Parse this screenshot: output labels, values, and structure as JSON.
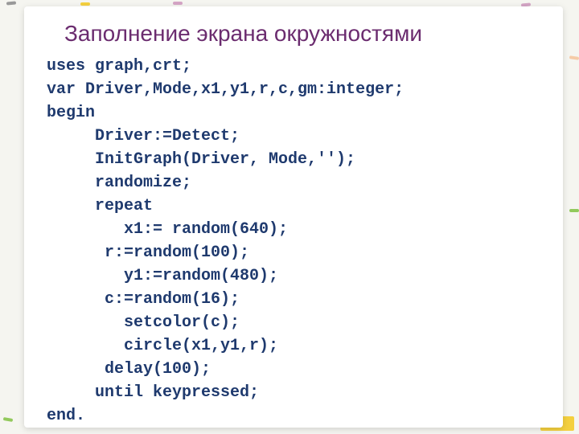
{
  "title": "Заполнение экрана окружностями",
  "code": "uses graph,crt;\nvar Driver,Mode,x1,y1,r,c,gm:integer;\nbegin\n     Driver:=Detect;\n     InitGraph(Driver, Mode,'');\n     randomize;\n     repeat\n        x1:= random(640);\n      r:=random(100);\n        y1:=random(480);\n      c:=random(16);\n        setcolor(c);\n        circle(x1,y1,r);\n      delay(100);\n     until keypressed;\nend."
}
